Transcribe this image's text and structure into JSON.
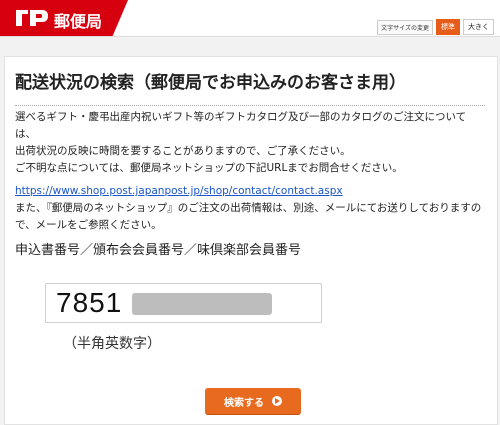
{
  "header": {
    "logo_text": "郵便局",
    "font_size_label": "文字サイズの変更",
    "font_standard": "標準",
    "font_large": "大きく"
  },
  "page": {
    "title": "配送状況の検索（郵便局でお申込みのお客さま用）",
    "notice_lines": [
      "選べるギフト・慶弔出産内祝いギフト等のギフトカタログ及び一部のカタログのご注文については、",
      "出荷状況の反映に時間を要することがありますので、ご了承ください。",
      "ご不明な点については、郵便局ネットショップの下記URLまでお問合せください。"
    ],
    "contact_url": "https://www.shop.post.japanpost.jp/shop/contact/contact.aspx",
    "notice_after_url": "また、『郵便局のネットショップ』のご注文の出荷情報は、別途、メールにてお送りしておりますので、メールをご参照ください。",
    "field_label": "申込書番号／頒布会会員番号／味倶楽部会員番号",
    "input_value": "7851",
    "input_hint": "（半角英数字）",
    "search_button": "検索する"
  },
  "colors": {
    "brand_red": "#d7000f",
    "button_orange": "#e86a1e",
    "link_blue": "#1a56c8"
  }
}
